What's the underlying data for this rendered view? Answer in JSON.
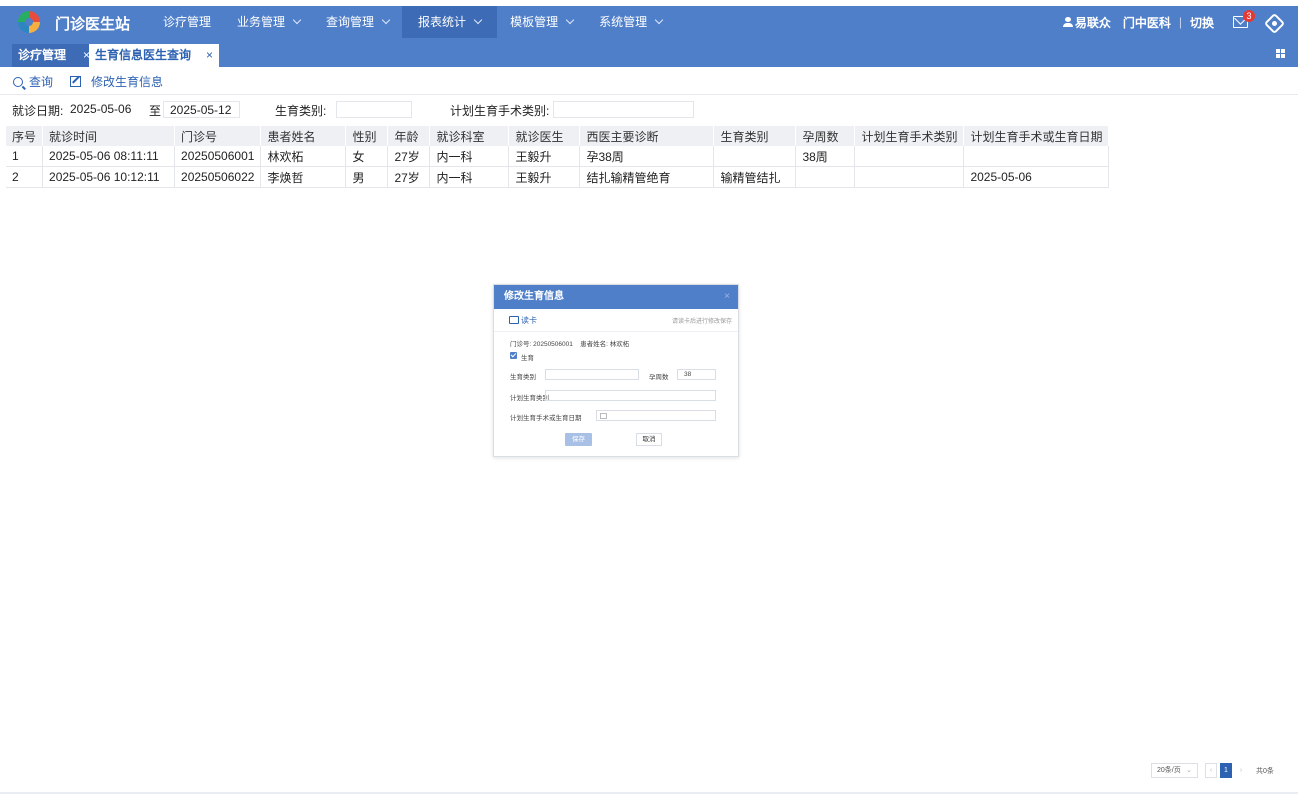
{
  "app": {
    "title": "门诊医生站"
  },
  "menu": [
    {
      "label": "诊疗管理",
      "has_arrow": false
    },
    {
      "label": "业务管理",
      "has_arrow": true
    },
    {
      "label": "查询管理",
      "has_arrow": true
    },
    {
      "label": "报表统计",
      "has_arrow": true,
      "active": true
    },
    {
      "label": "模板管理",
      "has_arrow": true
    },
    {
      "label": "系统管理",
      "has_arrow": true
    }
  ],
  "user": {
    "name": "易联众",
    "dept": "门中医科",
    "switch": "切换",
    "notice_count": "3"
  },
  "tabs": [
    {
      "label": "诊疗管理",
      "close": "×"
    },
    {
      "label": "生育信息医生查询",
      "close": "×"
    }
  ],
  "toolbar": {
    "query": "查询",
    "edit": "修改生育信息"
  },
  "filter": {
    "visit_date_label": "就诊日期:",
    "date_from": "2025-05-06",
    "to_label": "至",
    "date_to": "2025-05-12",
    "birth_type_label": "生育类别:",
    "plan_type_label": "计划生育手术类别:"
  },
  "table": {
    "columns": [
      "序号",
      "就诊时间",
      "门诊号",
      "患者姓名",
      "性别",
      "年龄",
      "就诊科室",
      "就诊医生",
      "西医主要诊断",
      "生育类别",
      "孕周数",
      "计划生育手术类别",
      "计划生育手术或生育日期"
    ],
    "rows": [
      [
        "1",
        "2025-05-06 08:11:11",
        "20250506001",
        "林欢柘",
        "女",
        "27岁",
        "内一科",
        "王毅升",
        "孕38周",
        "",
        "38周",
        "",
        ""
      ],
      [
        "2",
        "2025-05-06 10:12:11",
        "20250506022",
        "李焕哲",
        "男",
        "27岁",
        "内一科",
        "王毅升",
        "结扎输精管绝育",
        "输精管结扎",
        "",
        "",
        "2025-05-06"
      ]
    ]
  },
  "dialog": {
    "title": "修改生育信息",
    "close": "×",
    "read_card": "读卡",
    "hint": "请读卡后进行修改保存",
    "info": "门诊号: 20250506001    患者姓名: 林欢柘",
    "checkbox_label": "生育",
    "birth_type_label": "生育类别",
    "weeks_label": "孕周数",
    "weeks_value": "38",
    "plan_type_label": "计划生育类别",
    "plan_date_label": "计划生育手术或生育日期",
    "save": "保存",
    "cancel": "取消"
  },
  "pager": {
    "page_size": "20条/页",
    "prev": "‹",
    "current": "1",
    "next": "›",
    "total": "共0条"
  }
}
